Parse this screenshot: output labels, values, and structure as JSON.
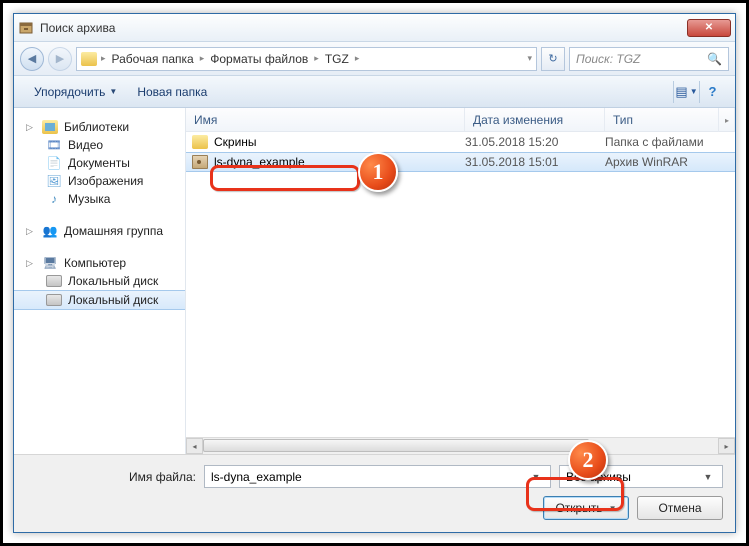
{
  "window": {
    "title": "Поиск архива"
  },
  "nav": {
    "back": "◀",
    "forward": "▶"
  },
  "breadcrumbs": {
    "items": [
      "Рабочая папка",
      "Форматы файлов",
      "TGZ"
    ],
    "refresh": "↻",
    "dropdown": "▾"
  },
  "search": {
    "placeholder": "Поиск: TGZ",
    "icon": "🔍"
  },
  "toolbar": {
    "organize": "Упорядочить",
    "newfolder": "Новая папка",
    "view_icon": "▤",
    "help_icon": "?"
  },
  "tree": {
    "libraries": "Библиотеки",
    "video": "Видео",
    "documents": "Документы",
    "images": "Изображения",
    "music": "Музыка",
    "homegroup": "Домашняя группа",
    "computer": "Компьютер",
    "localdisk1": "Локальный диск",
    "localdisk2": "Локальный диск"
  },
  "columns": {
    "name": "Имя",
    "date": "Дата изменения",
    "type": "Тип"
  },
  "files": [
    {
      "name": "Скрины",
      "date": "31.05.2018 15:20",
      "type": "Папка с файлами",
      "kind": "folder"
    },
    {
      "name": "ls-dyna_example",
      "date": "31.05.2018 15:01",
      "type": "Архив WinRAR",
      "kind": "archive",
      "selected": true
    }
  ],
  "bottom": {
    "filename_label": "Имя файла:",
    "filename_value": "ls-dyna_example",
    "filetype_value": "Все архивы",
    "open": "Открыть",
    "cancel": "Отмена"
  },
  "callouts": {
    "one": "1",
    "two": "2"
  }
}
